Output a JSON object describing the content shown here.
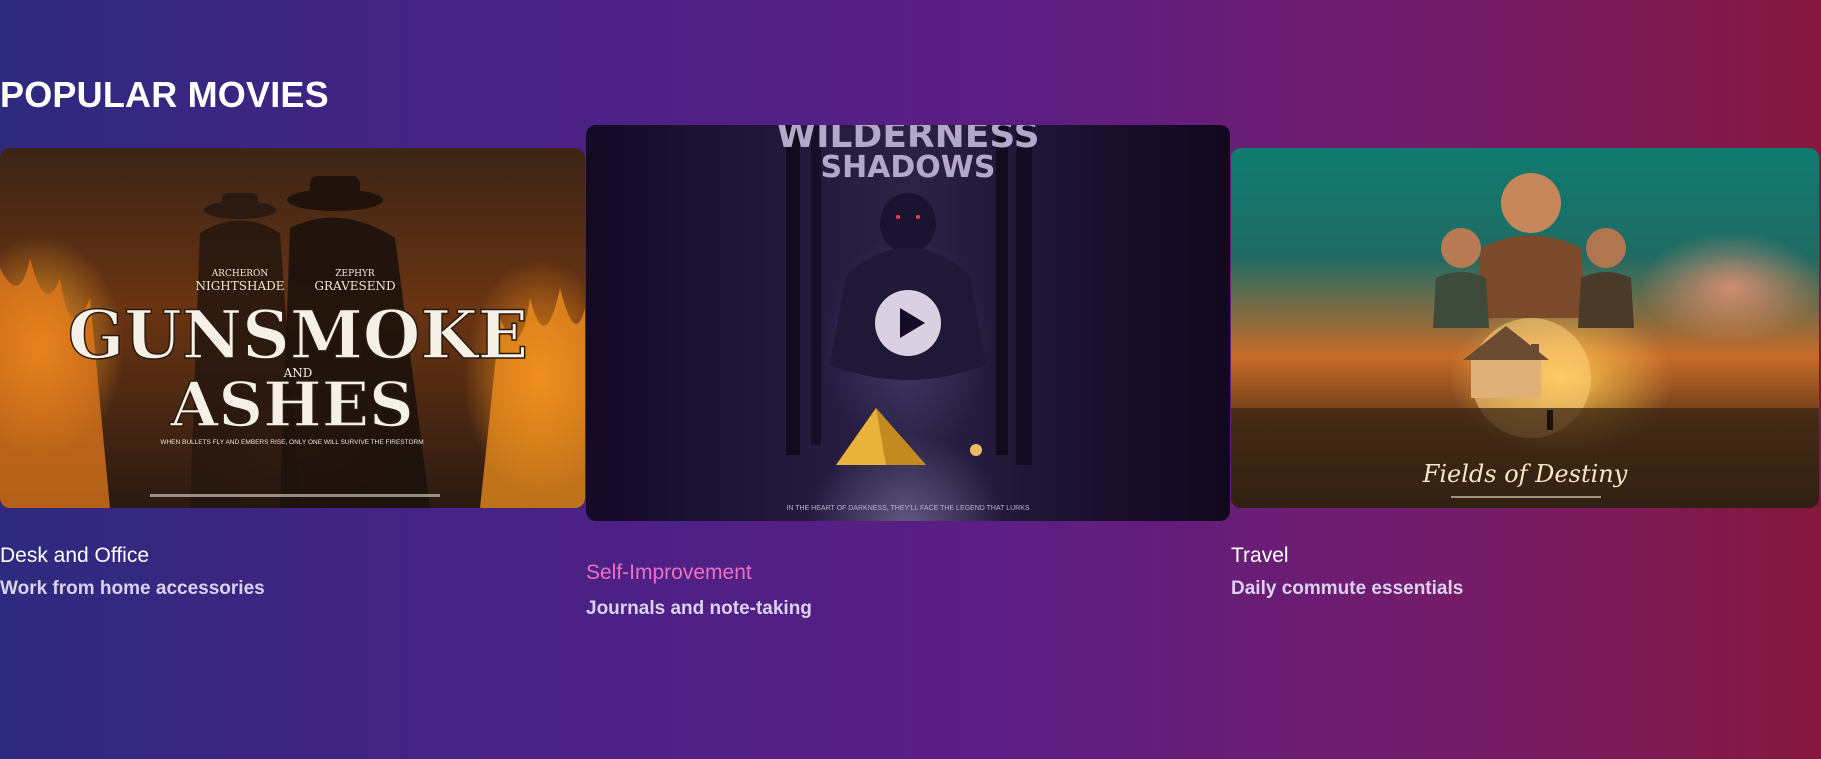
{
  "section": {
    "title": "POPULAR MOVIES"
  },
  "cards": [
    {
      "poster_text": {
        "actor1_first": "ARCHERON",
        "actor1_last": "NIGHTSHADE",
        "actor2_first": "ZEPHYR",
        "actor2_last": "GRAVESEND",
        "title_line1": "GUNSMOKE",
        "title_and": "AND",
        "title_line2": "ASHES",
        "tagline": "WHEN BULLETS FLY AND EMBERS RISE, ONLY ONE WILL SURVIVE THE FIRESTORM"
      },
      "title": "Desk and Office",
      "subtitle": "Work from home accessories"
    },
    {
      "poster_text": {
        "title_line1": "WILDERNESS",
        "title_line2": "SHADOWS",
        "tagline": "IN THE HEART OF DARKNESS, THEY'LL FACE THE LEGEND THAT LURKS"
      },
      "play_icon": "play-icon",
      "title": "Self-Improvement",
      "subtitle": "Journals and note-taking",
      "title_color": "#ef6fc4"
    },
    {
      "poster_text": {
        "title": "Fields of Destiny"
      },
      "title": "Travel",
      "subtitle": "Daily commute essentials"
    }
  ],
  "colors": {
    "background_start": "#2e2a7e",
    "background_end": "#85183f",
    "highlight_title": "#ef6fc4"
  }
}
